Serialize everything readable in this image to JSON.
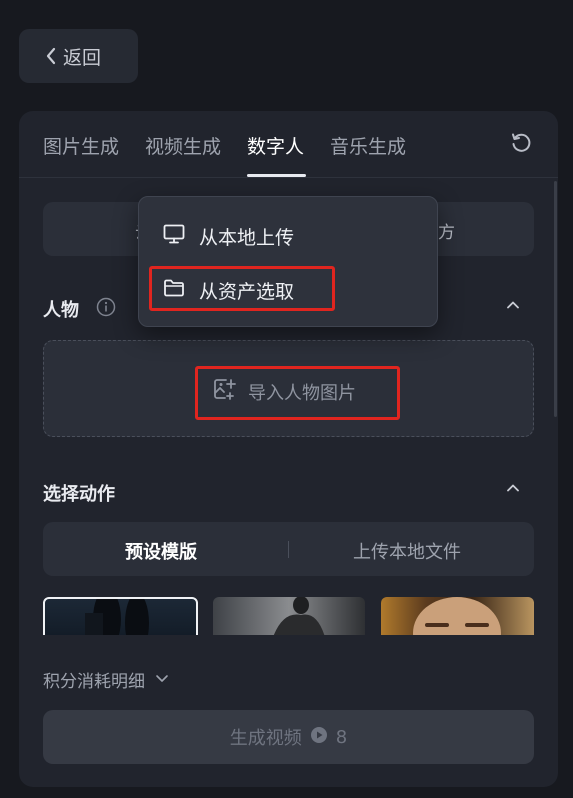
{
  "back": {
    "label": "返回"
  },
  "tabs": [
    {
      "label": "图片生成",
      "active": false
    },
    {
      "label": "视频生成",
      "active": false
    },
    {
      "label": "数字人",
      "active": true
    },
    {
      "label": "音乐生成",
      "active": false
    }
  ],
  "source_bar": {
    "left_fragment": "云",
    "right_fragment": "方"
  },
  "character": {
    "title": "人物",
    "upload_label": "导入人物图片"
  },
  "dropdown": {
    "items": [
      {
        "label": "从本地上传",
        "icon": "monitor-icon"
      },
      {
        "label": "从资产选取",
        "icon": "folder-icon"
      }
    ]
  },
  "action": {
    "title": "选择动作",
    "tabs": [
      {
        "label": "预设模版",
        "active": true
      },
      {
        "label": "上传本地文件",
        "active": false
      }
    ]
  },
  "cost": {
    "label": "积分消耗明细"
  },
  "generate": {
    "label": "生成视频",
    "credits": "8"
  },
  "colors": {
    "highlight": "#e0251f",
    "panel": "#21242d",
    "background": "#17191f"
  }
}
